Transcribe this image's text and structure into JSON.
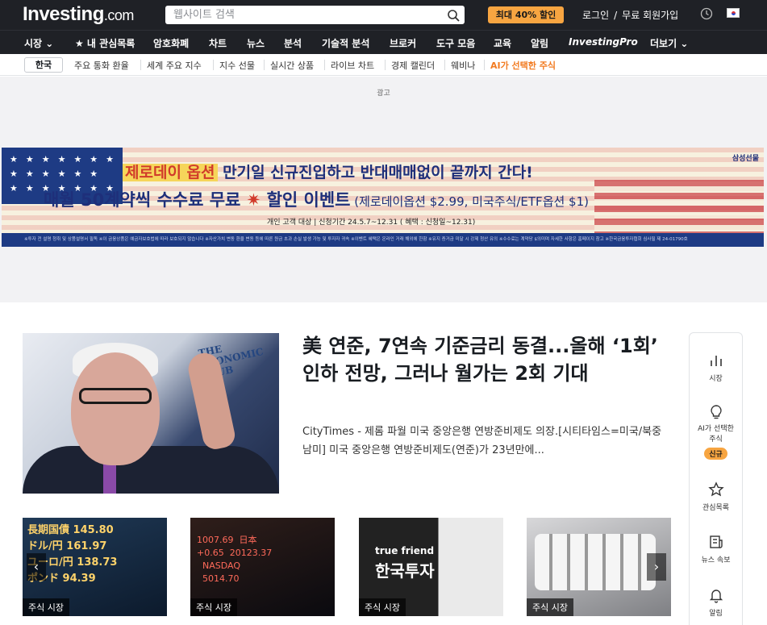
{
  "header": {
    "logo_main": "Investing",
    "logo_suffix": ".com",
    "search_placeholder": "웹사이트 검색",
    "promo_label": "최대 40% 할인",
    "login": "로그인",
    "divider": "/",
    "signup": "무료 회원가입"
  },
  "main_nav": {
    "items": [
      "시장",
      "★ 내 관심목록",
      "암호화폐",
      "차트",
      "뉴스",
      "분석",
      "기술적 분석",
      "브로커",
      "도구 모음",
      "교육",
      "알림",
      "InvestingPro",
      "더보기"
    ]
  },
  "sub_nav": {
    "active": "한국",
    "items": [
      "주요 통화 환율",
      "세계 주요 지수",
      "지수 선물",
      "실시간 상품",
      "라이브 차트",
      "경제 캘린더",
      "웨비나",
      "AI가 선택한 주식"
    ]
  },
  "ad": {
    "label": "광고",
    "brand": "삼성선물",
    "line1_hl": "제로데이 옵션",
    "line1_rest": " 만기일 신규진입하고 반대매매없이 끝까지 간다!",
    "line2_a": "매월 50계약씩 수수료 무료",
    "line2_star": " ✷ ",
    "line2_b": "할인 이벤트",
    "line2_small": " (제로데이옵션 $2.99, 미국주식/ETF옵션 $1)",
    "line3": "개인 고객 대상  |  신청기간 24.5.7~12.31 ( 혜택 : 신청일~12.31)",
    "disclaimer": "※투자 전 설명 청취 및 상품설명서 필독 ※이 금융상품은 예금자보호법에 따라 보호되지 않습니다 ※자산가치 변동 환율 변동 등에 따른 원금 초과 손실 발생 가능 및 투자자 귀속 ※이벤트 혜택은 온라인 거래 해외에 한함 ※유지 증거금 미달 시 강제 청산 유의 ※수수료는 계약당 $의미며 자세한 사항은 홈페이지 참고 ※한국금융투자협회 심사필 제 24-01790호"
  },
  "hero": {
    "image_sign": "THE ECONOMIC CLUB",
    "title": "美 연준, 7연속 기준금리 동결...올해 ‘1회’ 인하 전망, 그러나 월가는 2회 기대",
    "description": "CityTimes - 제롬 파월 미국 중앙은행 연방준비제도 의장.[시티타임스=미국/북중남미] 미국 중앙은행 연방준비제도(연준)가 23년만에..."
  },
  "thumbnails": [
    {
      "label": "주식 시장",
      "overlay": "長期国債\nドル/円\nユーロ/円\n"
    },
    {
      "label": "주식 시장",
      "overlay": "1007.69\n20123.37\nNASDAQ\n"
    },
    {
      "label": "주식 시장",
      "overlay": "true friend\n한국투자"
    },
    {
      "label": "주식 시장",
      "overlay": ""
    }
  ],
  "side_panel": {
    "items": [
      {
        "label": "시장",
        "icon": "bar-chart-icon"
      },
      {
        "label": "AI가 선택한 주식",
        "icon": "lightbulb-icon",
        "badge": "신규"
      },
      {
        "label": "관심목록",
        "icon": "star-icon"
      },
      {
        "label": "뉴스 속보",
        "icon": "news-icon"
      },
      {
        "label": "알림",
        "icon": "bell-icon"
      }
    ]
  },
  "colors": {
    "topbar": "#1f2126",
    "accent": "#f7a541",
    "ai_pick": "#f27b21"
  }
}
